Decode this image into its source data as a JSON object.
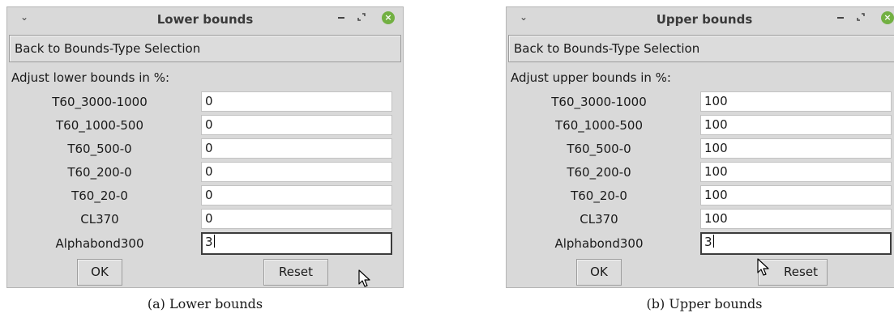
{
  "icons": {
    "window_menu": "chevron-down-icon",
    "minimize": "minimize-icon",
    "maximize": "maximize-icon",
    "close": "close-icon",
    "cursor": "mouse-pointer-icon"
  },
  "colors": {
    "window_bg": "#d9d9d9",
    "close_button": "#72b042",
    "input_bg": "#ffffff"
  },
  "lower": {
    "title": "Lower bounds",
    "back_button": "Back to Bounds-Type Selection",
    "adjust_label": "Adjust lower bounds in %:",
    "rows": [
      {
        "label": "T60_3000-1000",
        "value": "0"
      },
      {
        "label": "T60_1000-500",
        "value": "0"
      },
      {
        "label": "T60_500-0",
        "value": "0"
      },
      {
        "label": "T60_200-0",
        "value": "0"
      },
      {
        "label": "T60_20-0",
        "value": "0"
      },
      {
        "label": "CL370",
        "value": "0"
      },
      {
        "label": "Alphabond300",
        "value": "3"
      }
    ],
    "ok_button": "OK",
    "reset_button": "Reset",
    "caption": "(a) Lower bounds"
  },
  "upper": {
    "title": "Upper bounds",
    "back_button": "Back to Bounds-Type Selection",
    "adjust_label": "Adjust upper bounds in %:",
    "rows": [
      {
        "label": "T60_3000-1000",
        "value": "100"
      },
      {
        "label": "T60_1000-500",
        "value": "100"
      },
      {
        "label": "T60_500-0",
        "value": "100"
      },
      {
        "label": "T60_200-0",
        "value": "100"
      },
      {
        "label": "T60_20-0",
        "value": "100"
      },
      {
        "label": "CL370",
        "value": "100"
      },
      {
        "label": "Alphabond300",
        "value": "3"
      }
    ],
    "ok_button": "OK",
    "reset_button": "Reset",
    "caption": "(b) Upper bounds"
  }
}
